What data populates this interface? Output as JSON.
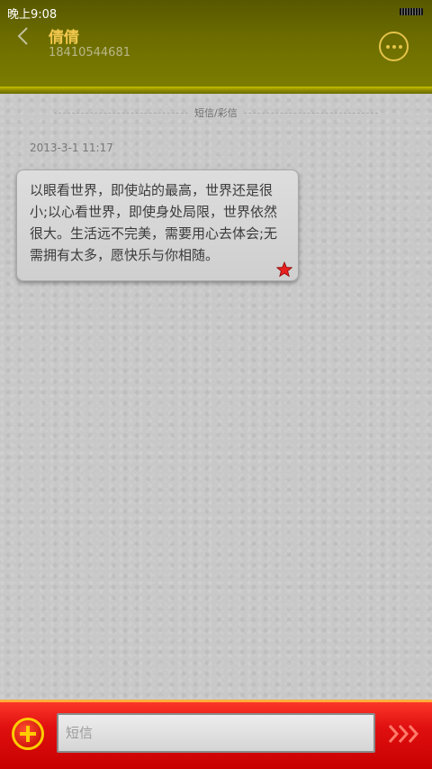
{
  "status_bar": {
    "time": "晚上9:08"
  },
  "header": {
    "back_icon": "chevron-left-icon",
    "contact_name": "倩倩",
    "contact_number": "18410544681",
    "more_icon": "more-dots-icon"
  },
  "conversation": {
    "type_label": "短信/彩信",
    "messages": [
      {
        "timestamp": "2013-3-1 11:17",
        "text": "以眼看世界，即使站的最高，世界还是很小;以心看世界，即使身处局限，世界依然很大。生活远不完美，需要用心去体会;无需拥有太多，愿快乐与你相随。",
        "starred": true,
        "star_icon": "star-icon"
      }
    ]
  },
  "composer": {
    "add_icon": "plus-circle-icon",
    "input_placeholder": "短信",
    "input_value": "",
    "send_icon": "send-arrows-icon"
  },
  "colors": {
    "header_bg": "#6d6d00",
    "name_gold": "#f2c94f",
    "bottom_bar_red": "#e01010",
    "accent_yellow": "#ffcc00"
  }
}
